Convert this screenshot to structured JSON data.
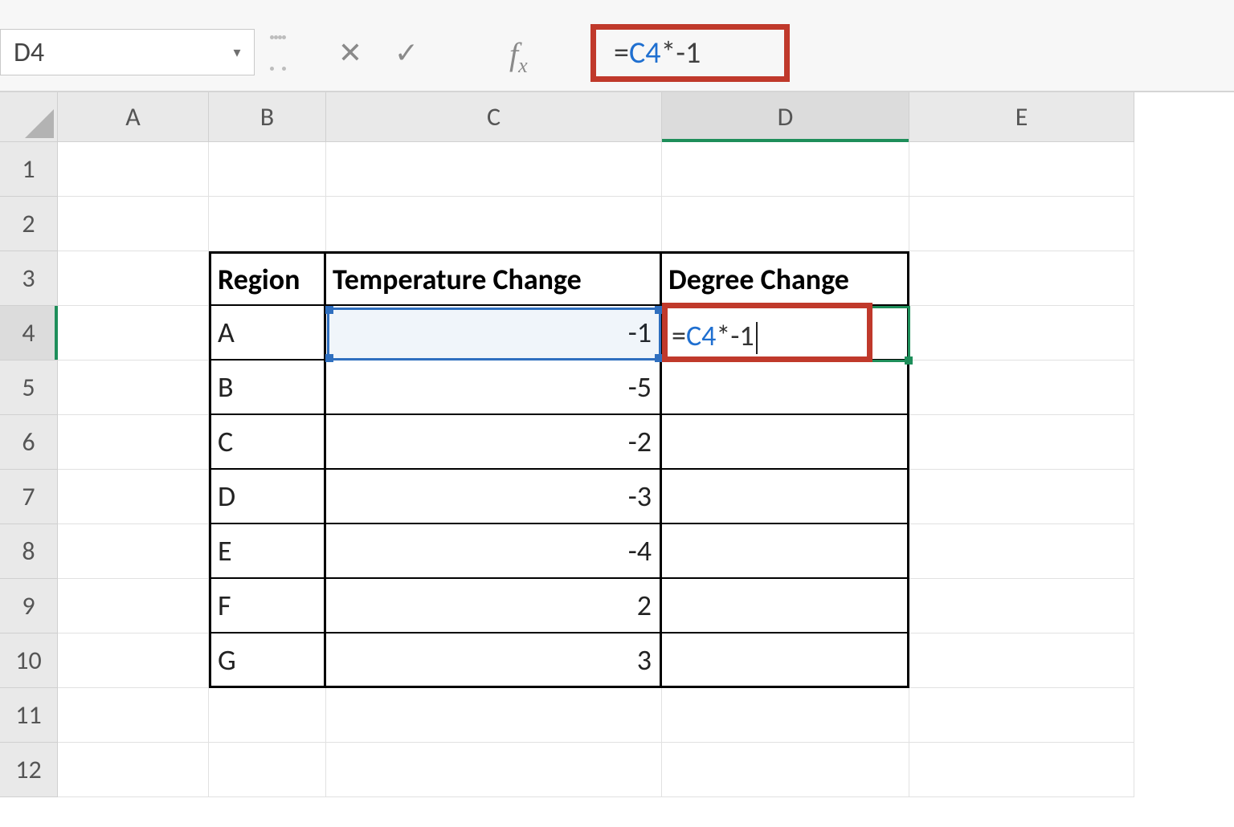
{
  "formula_bar": {
    "name_box": "D4",
    "cancel_glyph": "✕",
    "enter_glyph": "✓",
    "fx_label_main": "f",
    "fx_label_sub": "x",
    "formula_prefix": "=",
    "formula_ref": "C4",
    "formula_rest": "*-1"
  },
  "columns": [
    "A",
    "B",
    "C",
    "D",
    "E"
  ],
  "rows": [
    "1",
    "2",
    "3",
    "4",
    "5",
    "6",
    "7",
    "8",
    "9",
    "10",
    "11",
    "12"
  ],
  "active_col": "D",
  "active_row": "4",
  "table": {
    "headers": {
      "region": "Region",
      "temp_change": "Temperature Change",
      "degree_change": "Degree Change"
    },
    "rows": [
      {
        "region": "A",
        "temp": "-1"
      },
      {
        "region": "B",
        "temp": "-5"
      },
      {
        "region": "C",
        "temp": "-2"
      },
      {
        "region": "D",
        "temp": "-3"
      },
      {
        "region": "E",
        "temp": "-4"
      },
      {
        "region": "F",
        "temp": "2"
      },
      {
        "region": "G",
        "temp": "3"
      }
    ]
  },
  "edit_cell": {
    "prefix": "=",
    "ref": "C4",
    "rest": "*-1"
  }
}
